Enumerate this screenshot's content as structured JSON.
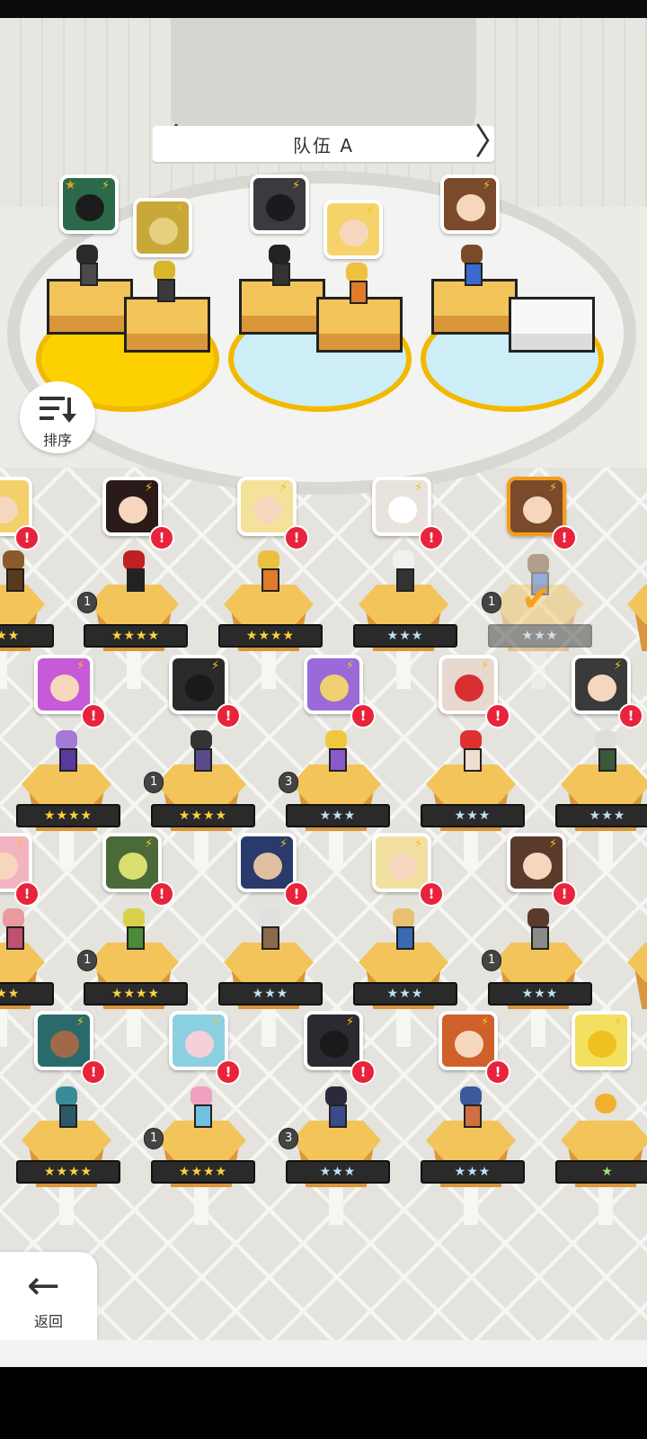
{
  "team": {
    "title": "队伍 A",
    "prev_glyph": "〈",
    "next_glyph": "〉"
  },
  "sort_button": {
    "label": "排序"
  },
  "back_button": {
    "label": "返回",
    "glyph": "←"
  },
  "rank_text": {
    "four": "★★★★",
    "three": "★★★",
    "one": "★"
  },
  "counts": {
    "one": "1",
    "three": "3"
  },
  "alert_glyph": "!",
  "bolt_glyph": "⚡",
  "check_glyph": "✔",
  "colors": {
    "gold_rank": "#ffd23a",
    "silver_rank": "#bde0f6",
    "alert": "#e8233b",
    "selected": "#f59b1c"
  }
}
